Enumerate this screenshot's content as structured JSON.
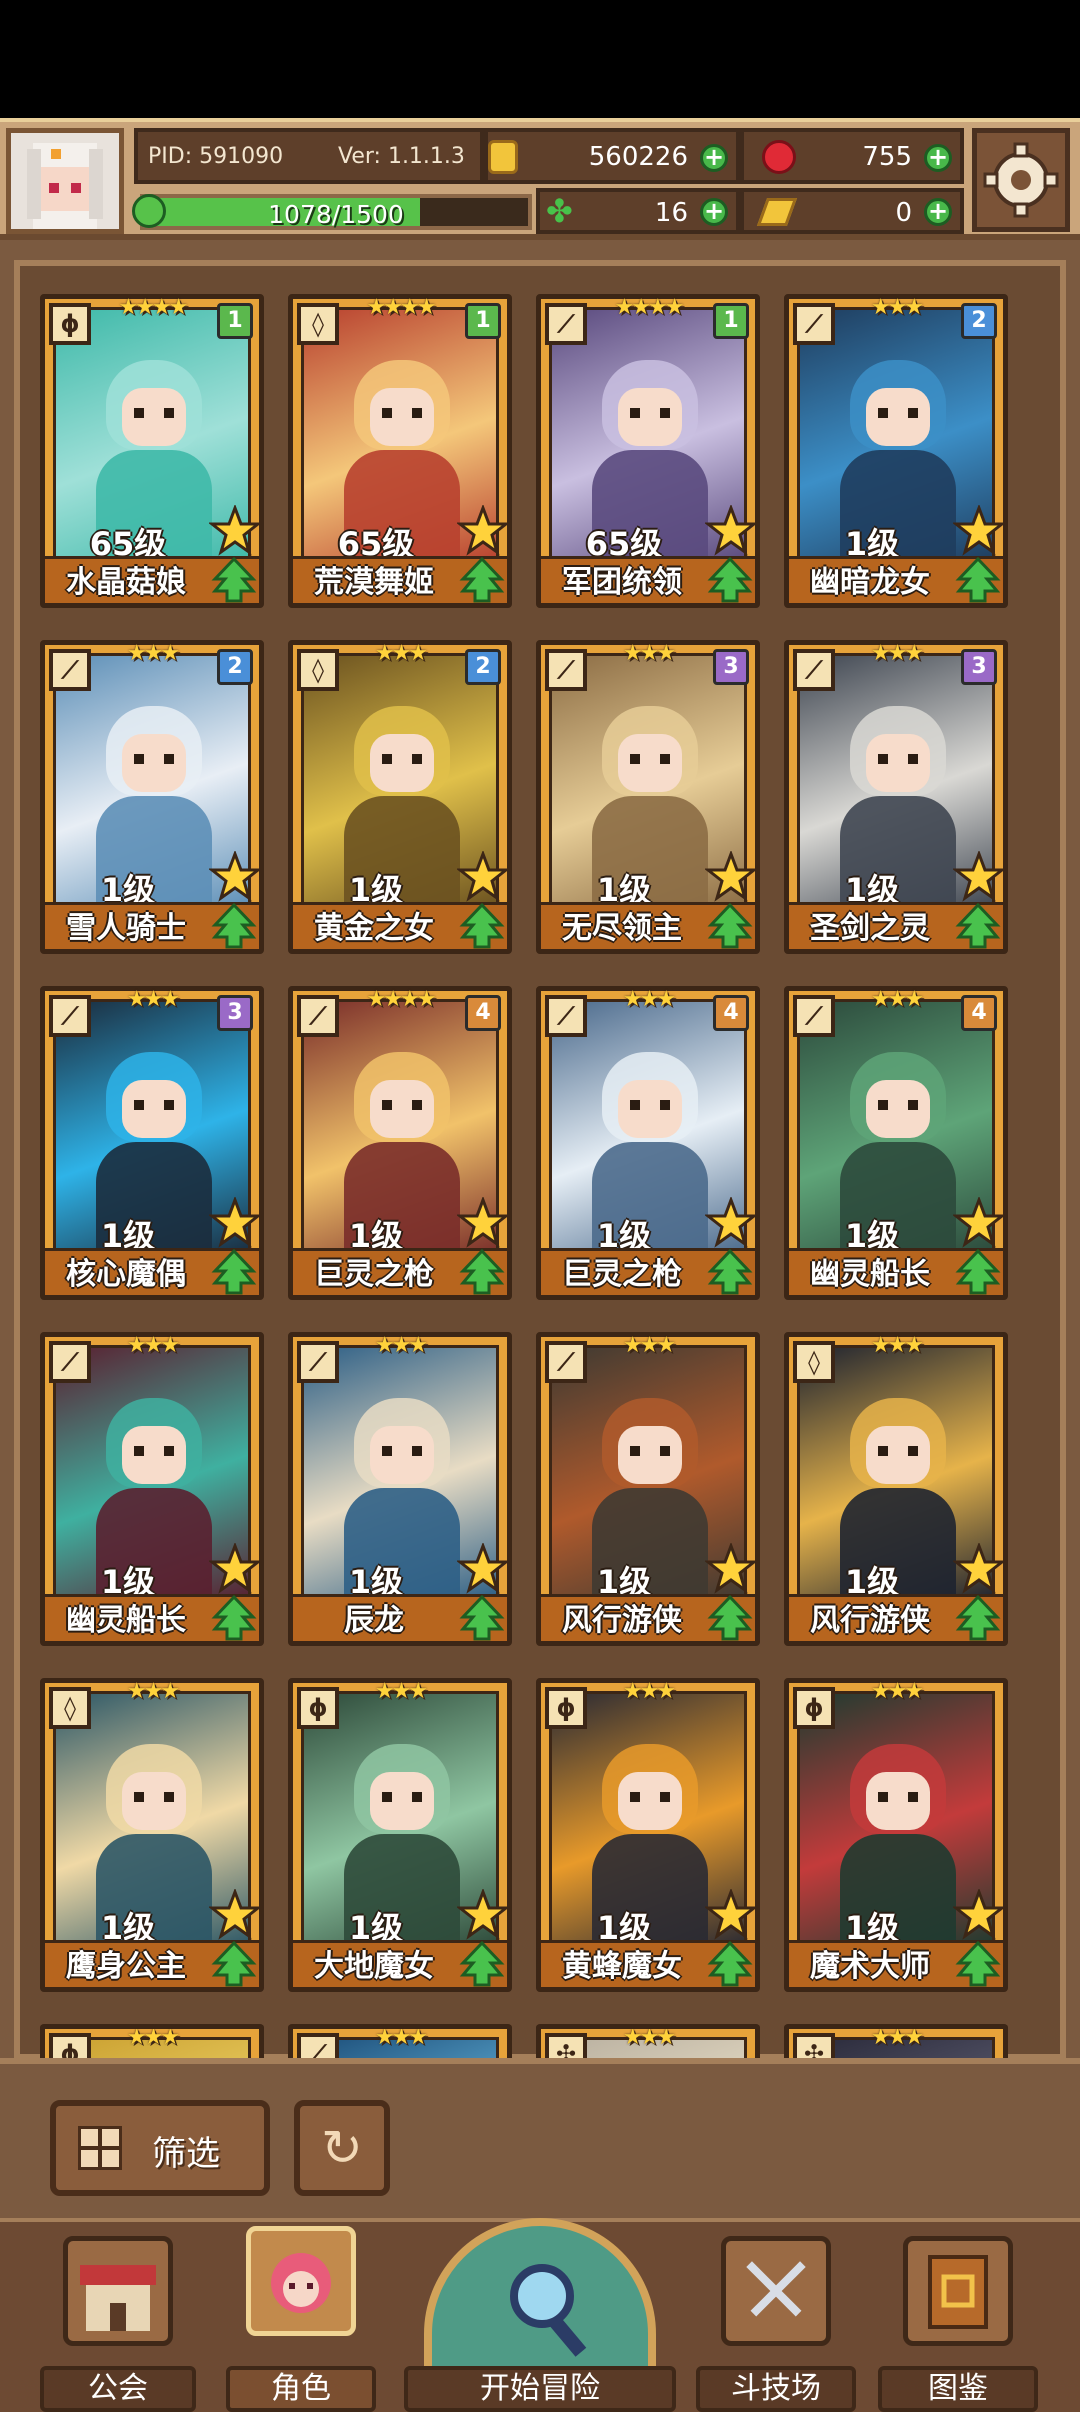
{
  "hud": {
    "pid": "PID: 591090",
    "version": "Ver: 1.1.1.3",
    "gold": "560226",
    "gems": "755",
    "xp_text": "1078/1500",
    "xp_progress": 0.719,
    "clover": "16",
    "keys": "0"
  },
  "cards": [
    {
      "name": "水晶菇娘",
      "level": "65级",
      "rank": "1",
      "stars": "★★★★",
      "type": "staff",
      "rank_color": "#5bb84d",
      "art": [
        "#3fb9a9",
        "#9fe0d8"
      ]
    },
    {
      "name": "荒漠舞姬",
      "level": "65级",
      "rank": "1",
      "stars": "★★★★",
      "type": "shield",
      "rank_color": "#5bb84d",
      "art": [
        "#b8412f",
        "#f4c77a"
      ]
    },
    {
      "name": "军团统领",
      "level": "65级",
      "rank": "1",
      "stars": "★★★★",
      "type": "sword",
      "rank_color": "#5bb84d",
      "art": [
        "#5a4a7e",
        "#c9bfe0"
      ]
    },
    {
      "name": "幽暗龙女",
      "level": "1级",
      "rank": "2",
      "stars": "★★★",
      "type": "sword",
      "rank_color": "#4a8fd8",
      "art": [
        "#1f3d5e",
        "#3c8fc7"
      ]
    },
    {
      "name": "雪人骑士",
      "level": "1级",
      "rank": "2",
      "stars": "★★★",
      "type": "sword",
      "rank_color": "#4a8fd8",
      "art": [
        "#5d8fb7",
        "#e8eef5"
      ]
    },
    {
      "name": "黄金之女",
      "level": "1级",
      "rank": "2",
      "stars": "★★★",
      "type": "shield",
      "rank_color": "#4a8fd8",
      "art": [
        "#6b5220",
        "#e0c04a"
      ]
    },
    {
      "name": "无尽领主",
      "level": "1级",
      "rank": "3",
      "stars": "★★★",
      "type": "sword",
      "rank_color": "#9a6ac7",
      "art": [
        "#8c6d45",
        "#e6cc96"
      ]
    },
    {
      "name": "圣剑之灵",
      "level": "1级",
      "rank": "3",
      "stars": "★★★",
      "type": "sword",
      "rank_color": "#9a6ac7",
      "art": [
        "#3f4651",
        "#d9d8d4"
      ]
    },
    {
      "name": "核心魔偶",
      "level": "1级",
      "rank": "3",
      "stars": "★★★",
      "type": "sword",
      "rank_color": "#9a6ac7",
      "art": [
        "#1b2c3d",
        "#2eb3e8"
      ]
    },
    {
      "name": "巨灵之枪",
      "level": "1级",
      "rank": "4",
      "stars": "★★★★",
      "type": "sword",
      "rank_color": "#d98a3a",
      "art": [
        "#7a2e2a",
        "#f1c26a"
      ]
    },
    {
      "name": "巨灵之枪",
      "level": "1级",
      "rank": "4",
      "stars": "★★★",
      "type": "sword",
      "rank_color": "#d98a3a",
      "art": [
        "#4b6a8c",
        "#e6eef5"
      ]
    },
    {
      "name": "幽灵船长",
      "level": "1级",
      "rank": "4",
      "stars": "★★★",
      "type": "sword",
      "rank_color": "#d98a3a",
      "art": [
        "#2c4a3c",
        "#5ea478"
      ]
    },
    {
      "name": "幽灵船长",
      "level": "1级",
      "rank": "",
      "stars": "★★★",
      "type": "sword",
      "rank_color": "",
      "art": [
        "#5a2030",
        "#3fb0a0"
      ]
    },
    {
      "name": "辰龙",
      "level": "1级",
      "rank": "",
      "stars": "★★★",
      "type": "sword",
      "rank_color": "",
      "art": [
        "#2d5f86",
        "#e8dcc4"
      ]
    },
    {
      "name": "风行游侠",
      "level": "1级",
      "rank": "",
      "stars": "★★★",
      "type": "sword",
      "rank_color": "",
      "art": [
        "#3f3a32",
        "#b05a2c"
      ]
    },
    {
      "name": "风行游侠",
      "level": "1级",
      "rank": "",
      "stars": "★★★",
      "type": "shield",
      "rank_color": "",
      "art": [
        "#1e2330",
        "#e6b34a"
      ]
    },
    {
      "name": "鹰身公主",
      "level": "1级",
      "rank": "",
      "stars": "★★★",
      "type": "shield",
      "rank_color": "",
      "art": [
        "#2c5766",
        "#f0d9a6"
      ]
    },
    {
      "name": "大地魔女",
      "level": "1级",
      "rank": "",
      "stars": "★★★",
      "type": "staff",
      "rank_color": "",
      "art": [
        "#2e4a3a",
        "#8fc6a2"
      ]
    },
    {
      "name": "黄蜂魔女",
      "level": "1级",
      "rank": "",
      "stars": "★★★",
      "type": "staff",
      "rank_color": "",
      "art": [
        "#2a2a33",
        "#e89a2a"
      ]
    },
    {
      "name": "魔术大师",
      "level": "1级",
      "rank": "",
      "stars": "★★★",
      "type": "staff",
      "rank_color": "",
      "art": [
        "#1f3b30",
        "#c33b3b"
      ]
    }
  ],
  "partial_cards": [
    {
      "stars": "★★★",
      "type": "staff",
      "art": [
        "#caa030",
        "#f4dc72"
      ]
    },
    {
      "stars": "★★★",
      "type": "sword",
      "art": [
        "#1d4f7a",
        "#73c9ef"
      ]
    },
    {
      "stars": "★★★",
      "type": "target",
      "art": [
        "#b9b0a0",
        "#f5ead0"
      ]
    },
    {
      "stars": "★★★",
      "type": "target",
      "art": [
        "#2a2a3a",
        "#6a6a80"
      ]
    }
  ],
  "filter": {
    "label": "筛选"
  },
  "nav": [
    {
      "label": "公会",
      "icon": "guild-icon"
    },
    {
      "label": "角色",
      "icon": "character-icon"
    },
    {
      "label": "开始冒险",
      "icon": "adventure-icon"
    },
    {
      "label": "斗技场",
      "icon": "arena-icon"
    },
    {
      "label": "图鉴",
      "icon": "codex-icon"
    }
  ],
  "colors": {
    "hud_bg": "#caa57b",
    "frame": "#7b5a40",
    "card": "#e7a33a",
    "plus": "#48b84a"
  }
}
